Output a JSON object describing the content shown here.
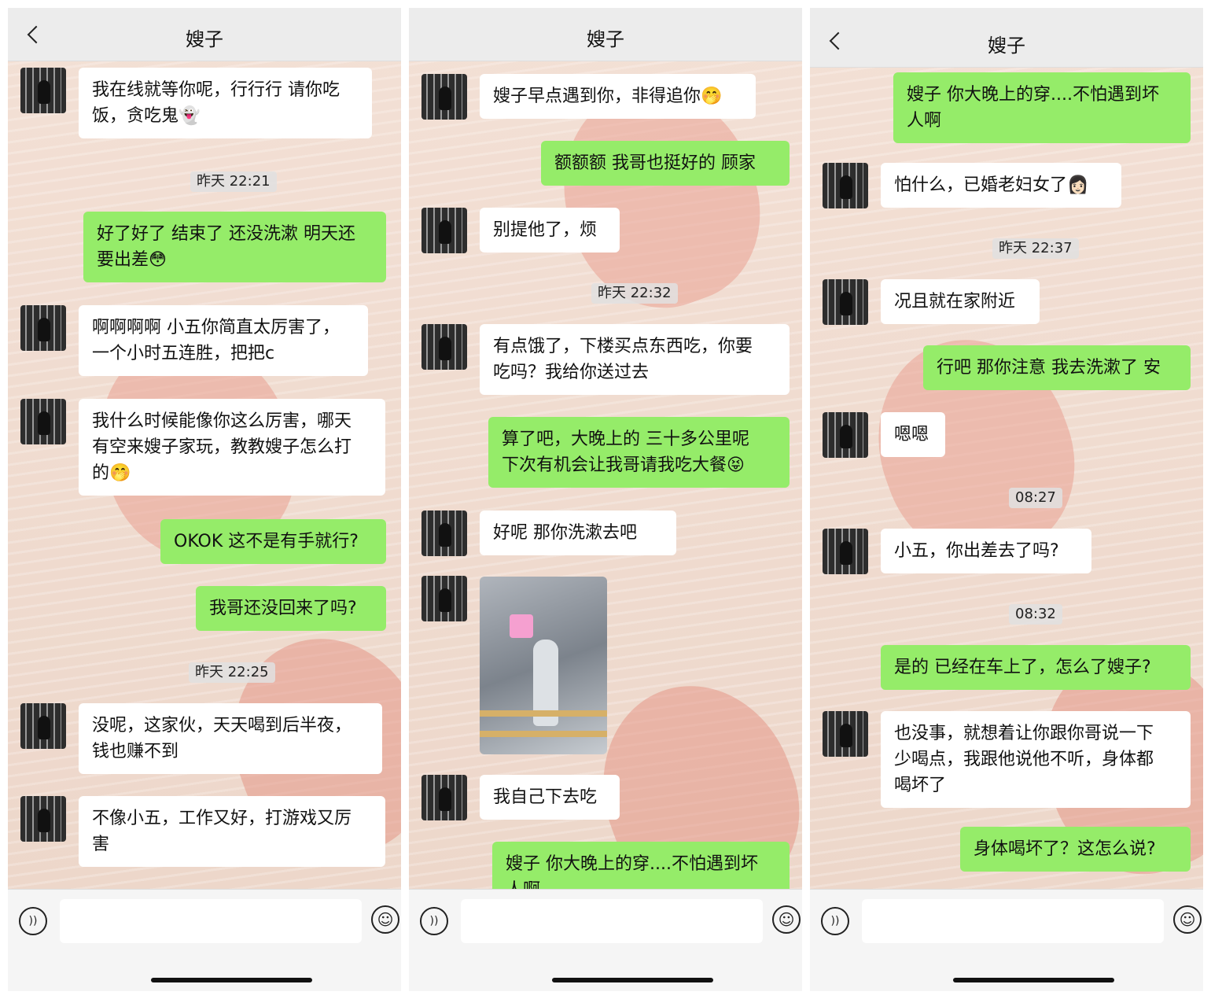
{
  "panels": [
    {
      "title": "嫂子",
      "messages": [
        {
          "side": "left",
          "text": "我在线就等你呢，行行行 请你吃\n饭，贪吃鬼👻"
        },
        {
          "side": "time",
          "text": "昨天 22:21"
        },
        {
          "side": "right",
          "text": "好了好了 结束了 还没洗漱 明天还\n要出差😳"
        },
        {
          "side": "left",
          "text": "啊啊啊啊 小五你简直太厉害了，\n一个小时五连胜，把把c"
        },
        {
          "side": "left",
          "text": "我什么时候能像你这么厉害，哪天\n有空来嫂子家玩，教教嫂子怎么打\n的🤭"
        },
        {
          "side": "right",
          "text": "OKOK 这不是有手就行?"
        },
        {
          "side": "right",
          "text": "我哥还没回来了吗?"
        },
        {
          "side": "time",
          "text": "昨天 22:25"
        },
        {
          "side": "left",
          "text": "没呢，这家伙，天天喝到后半夜，\n钱也赚不到"
        },
        {
          "side": "left",
          "text": "不像小五，工作又好，打游戏又厉\n害"
        }
      ]
    },
    {
      "title": "嫂子",
      "messages": [
        {
          "side": "left",
          "text": "嫂子早点遇到你，非得追你🤭"
        },
        {
          "side": "right",
          "text": "额额额 我哥也挺好的 顾家"
        },
        {
          "side": "left",
          "text": "别提他了，烦"
        },
        {
          "side": "time",
          "text": "昨天 22:32"
        },
        {
          "side": "left",
          "text": "有点饿了，下楼买点东西吃，你要\n吃吗？我给你送过去"
        },
        {
          "side": "right",
          "text": "算了吧，大晚上的 三十多公里呢\n下次有机会让我哥请我吃大餐😝"
        },
        {
          "side": "left",
          "text": "好呢  那你洗漱去吧"
        },
        {
          "side": "image",
          "text": ""
        },
        {
          "side": "left",
          "text": "我自己下去吃"
        },
        {
          "side": "right",
          "text": "嫂子 你大晚上的穿....不怕遇到坏\n人啊"
        }
      ]
    },
    {
      "title": "嫂子",
      "messages": [
        {
          "side": "right",
          "text": "嫂子 你大晚上的穿....不怕遇到坏\n人啊"
        },
        {
          "side": "left",
          "text": "怕什么，已婚老妇女了👩🏻"
        },
        {
          "side": "time",
          "text": "昨天 22:37"
        },
        {
          "side": "left",
          "text": "况且就在家附近"
        },
        {
          "side": "right",
          "text": "行吧 那你注意 我去洗漱了 安"
        },
        {
          "side": "left",
          "text": "嗯嗯"
        },
        {
          "side": "time",
          "text": "08:27"
        },
        {
          "side": "left",
          "text": "小五，你出差去了吗?"
        },
        {
          "side": "time",
          "text": "08:32"
        },
        {
          "side": "right",
          "text": "是的 已经在车上了，怎么了嫂子?"
        },
        {
          "side": "left",
          "text": "也没事，就想着让你跟你哥说一下\n少喝点，我跟他说他不听，身体都\n喝坏了"
        },
        {
          "side": "right",
          "text": "身体喝坏了？这怎么说?"
        }
      ]
    }
  ]
}
